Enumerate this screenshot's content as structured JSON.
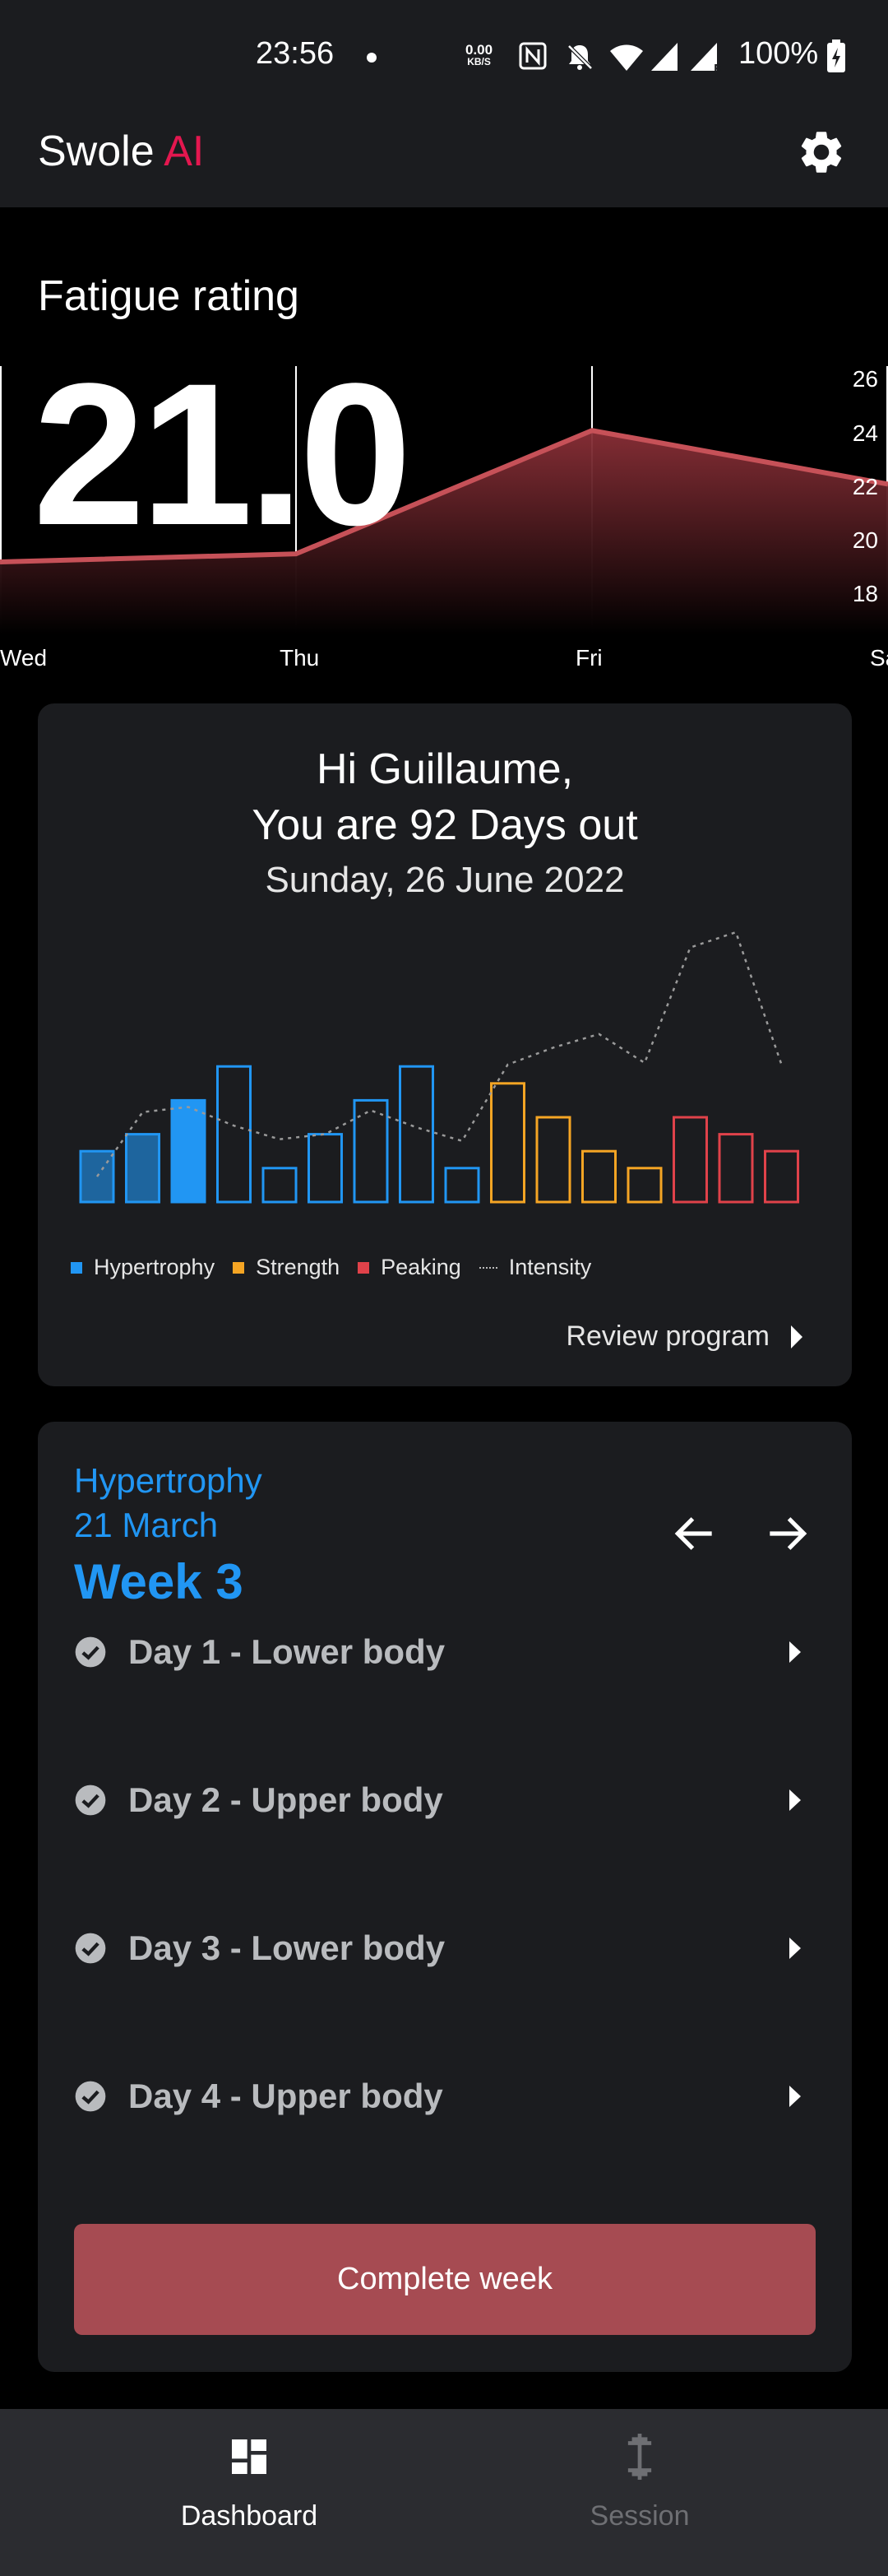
{
  "status_bar": {
    "time": "23:56",
    "net_speed_value": "0.00",
    "net_speed_unit": "KB/S",
    "battery": "100%"
  },
  "app": {
    "title_main": "Swole",
    "title_accent": "AI",
    "accent_color": "#e3174f"
  },
  "fatigue": {
    "title": "Fatigue rating",
    "value": "21.0",
    "line_color": "#c65158",
    "chart_data": {
      "type": "area",
      "x": [
        "Wed",
        "Thu",
        "Fri",
        "Sat"
      ],
      "values": [
        19.2,
        19.5,
        24.1,
        22.1
      ],
      "ylim": [
        16.5,
        26.5
      ],
      "yticks": [
        "26",
        "24",
        "22",
        "20",
        "18"
      ],
      "grid": true
    }
  },
  "greeting": {
    "line1": "Hi Guillaume,",
    "line2": "You are 92 Days out",
    "date": "Sunday, 26 June 2022"
  },
  "program_chart": {
    "chart_data": {
      "type": "bar",
      "ylim": [
        0,
        10
      ],
      "series": [
        {
          "name": "Hypertrophy",
          "color": "#2196f3",
          "values": [
            3,
            4,
            6,
            8,
            2,
            4,
            6,
            8,
            2,
            null,
            null,
            null,
            null,
            null,
            null,
            null
          ]
        },
        {
          "name": "Strength",
          "color": "#f5a524",
          "values": [
            null,
            null,
            null,
            null,
            null,
            null,
            null,
            null,
            null,
            7,
            5,
            3,
            2,
            null,
            null,
            null
          ]
        },
        {
          "name": "Peaking",
          "color": "#e0424a",
          "values": [
            null,
            null,
            null,
            null,
            null,
            null,
            null,
            null,
            null,
            null,
            null,
            null,
            null,
            5,
            4,
            3
          ]
        },
        {
          "name": "Intensity",
          "color": "#9a9a9a",
          "values": [
            1.5,
            5.3,
            5.6,
            4.5,
            3.7,
            4,
            5.4,
            4.4,
            3.6,
            8.1,
            9.1,
            9.9,
            8.2,
            15,
            15.9,
            8.1
          ]
        }
      ],
      "filled_bars": [
        0,
        1,
        2
      ],
      "current_bar": 2
    },
    "legend": [
      "Hypertrophy",
      "Strength",
      "Peaking",
      "Intensity"
    ],
    "review_label": "Review program"
  },
  "week_card": {
    "phase": "Hypertrophy",
    "date": "21 March",
    "week": "Week 3",
    "days": [
      {
        "label": "Day 1 - Lower body"
      },
      {
        "label": "Day 2 - Upper body"
      },
      {
        "label": "Day 3 - Lower body"
      },
      {
        "label": "Day 4 - Upper body"
      }
    ],
    "complete_label": "Complete week"
  },
  "bottom_nav": {
    "dashboard": "Dashboard",
    "session": "Session"
  }
}
